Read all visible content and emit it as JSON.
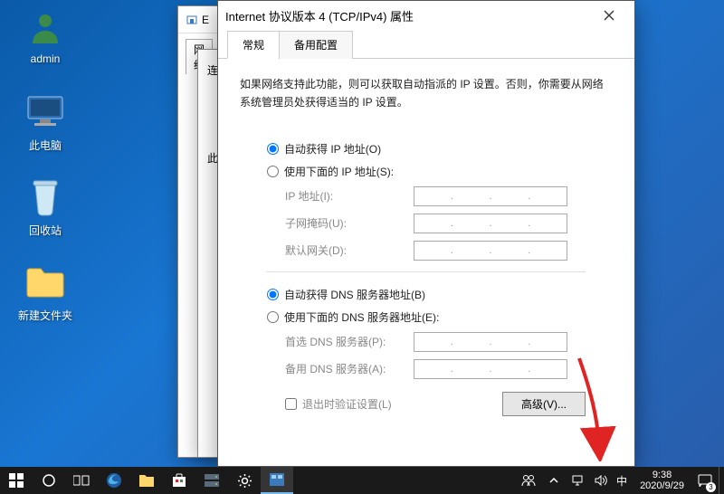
{
  "desktop_icons": [
    {
      "label": "admin",
      "kind": "user"
    },
    {
      "label": "此电脑",
      "kind": "pc"
    },
    {
      "label": "回收站",
      "kind": "trash"
    },
    {
      "label": "新建文件夹",
      "kind": "folder"
    }
  ],
  "bg_window1": {
    "title_prefix": "E",
    "tab": "网络"
  },
  "bg_window2": {
    "body_line1": "连",
    "body_line2": "此"
  },
  "dialog": {
    "title": "Internet 协议版本 4 (TCP/IPv4) 属性",
    "tabs": {
      "general": "常规",
      "alternate": "备用配置"
    },
    "intro": "如果网络支持此功能，则可以获取自动指派的 IP 设置。否则，你需要从网络系统管理员处获得适当的 IP 设置。",
    "ip_auto": "自动获得 IP 地址(O)",
    "ip_manual": "使用下面的 IP 地址(S):",
    "ip_fields": {
      "address": "IP 地址(I):",
      "mask": "子网掩码(U):",
      "gateway": "默认网关(D):"
    },
    "dns_auto": "自动获得 DNS 服务器地址(B)",
    "dns_manual": "使用下面的 DNS 服务器地址(E):",
    "dns_fields": {
      "preferred": "首选 DNS 服务器(P):",
      "alternate": "备用 DNS 服务器(A):"
    },
    "validate": "退出时验证设置(L)",
    "advanced": "高级(V)..."
  },
  "taskbar": {
    "ime": "中",
    "time": "9:38",
    "date": "2020/9/29",
    "notif_count": "3"
  }
}
